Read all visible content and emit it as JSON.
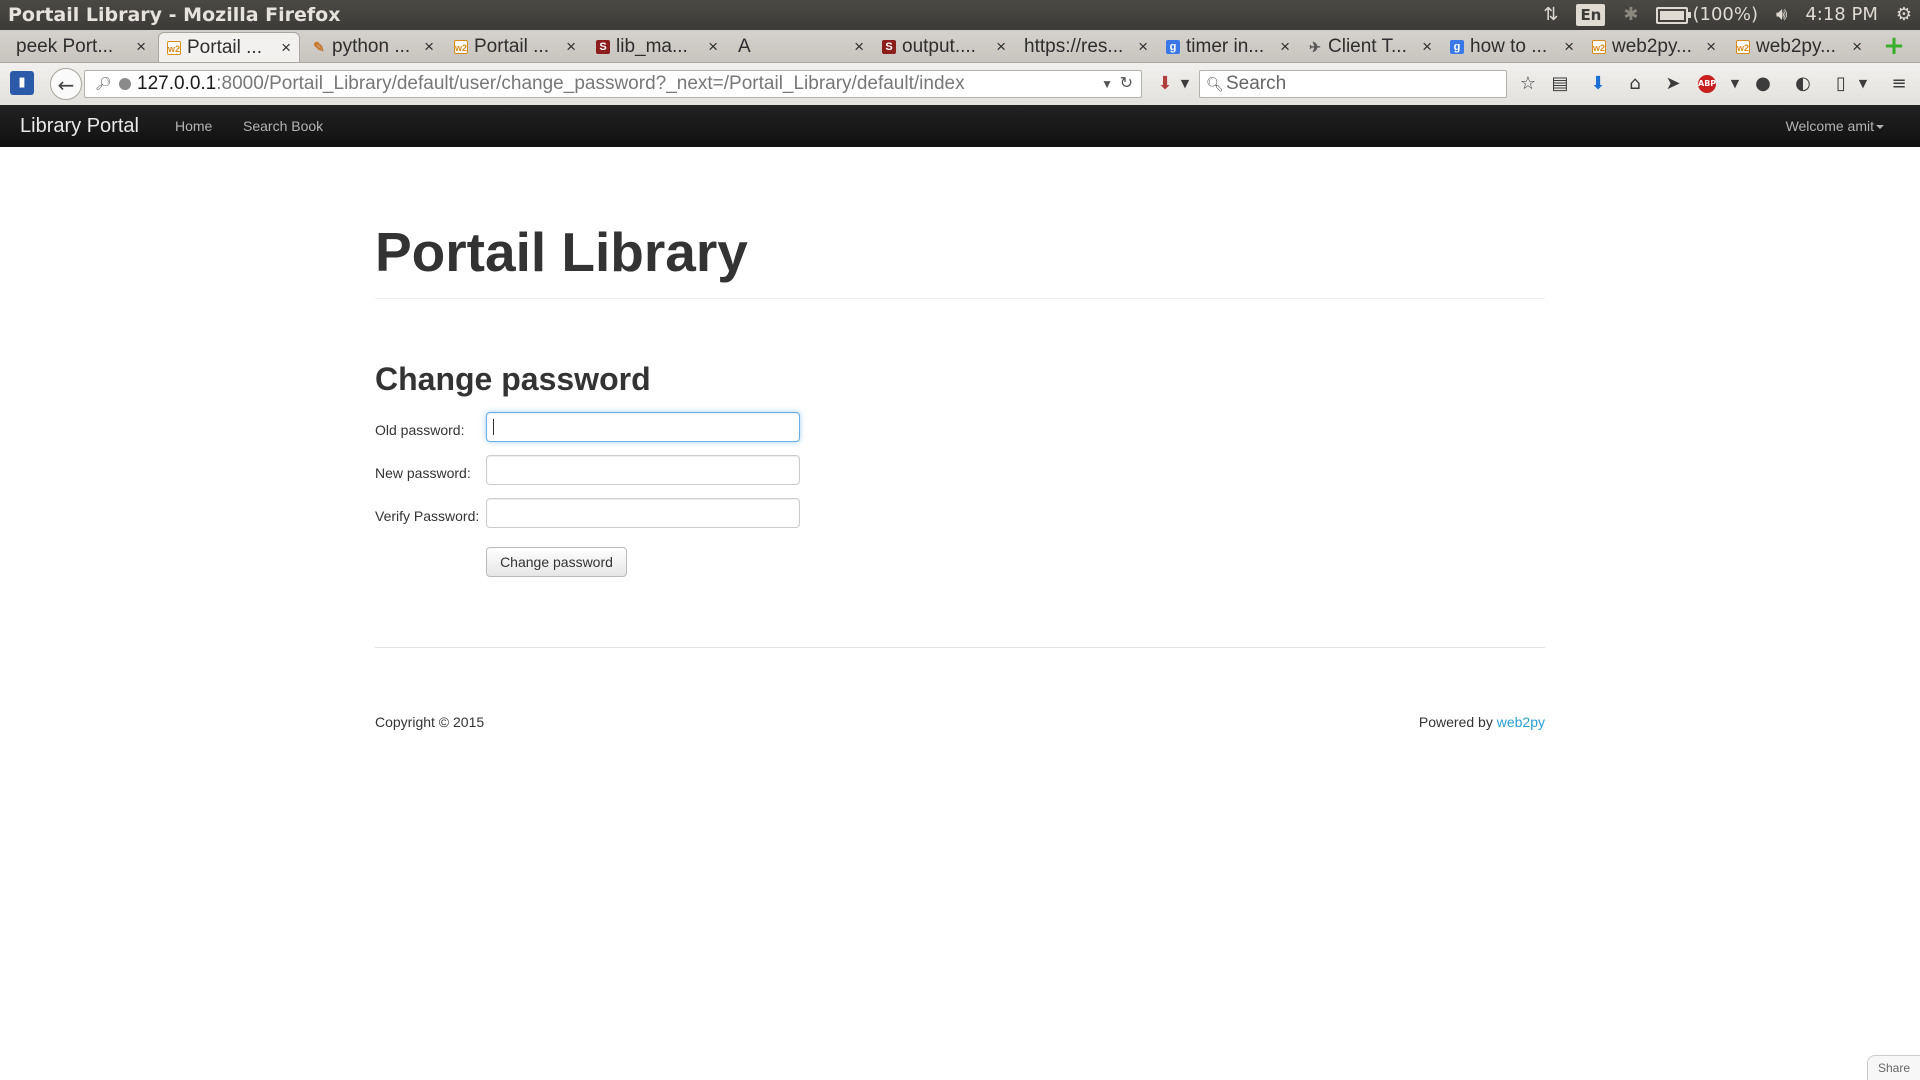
{
  "os": {
    "window_title": "Portail Library - Mozilla Firefox",
    "lang": "En",
    "battery": "(100%)",
    "battery_level": 1.0,
    "time": "4:18 PM"
  },
  "tabs": [
    {
      "label": "peek Port...",
      "icon": "none",
      "active": false
    },
    {
      "label": "Portail ...",
      "icon": "web2py-icon",
      "active": true
    },
    {
      "label": "python ...",
      "icon": "python-icon",
      "active": false
    },
    {
      "label": "Portail ...",
      "icon": "web2py-icon",
      "active": false
    },
    {
      "label": "lib_ma...",
      "icon": "stackoverflow-icon",
      "active": false
    },
    {
      "label": "A",
      "icon": "none",
      "active": false
    },
    {
      "label": "output....",
      "icon": "stackoverflow-icon",
      "active": false
    },
    {
      "label": "https://res...",
      "icon": "none",
      "active": false
    },
    {
      "label": "timer in...",
      "icon": "google-icon",
      "active": false
    },
    {
      "label": "Client T...",
      "icon": "client-icon",
      "active": false
    },
    {
      "label": "how to ...",
      "icon": "google-icon",
      "active": false
    },
    {
      "label": "web2py...",
      "icon": "web2py-icon",
      "active": false
    },
    {
      "label": "web2py...",
      "icon": "web2py-icon",
      "active": false
    }
  ],
  "toolbar": {
    "url_host": "127.0.0.1",
    "url_path": ":8000/Portail_Library/default/user/change_password?_next=/Portail_Library/default/index",
    "search_placeholder": "Search"
  },
  "app": {
    "brand": "Library Portal",
    "nav_home": "Home",
    "nav_search": "Search Book",
    "welcome": "Welcome amit"
  },
  "main": {
    "title": "Portail Library",
    "form_title": "Change password",
    "old_label": "Old password:",
    "new_label": "New password:",
    "verify_label": "Verify Password:",
    "old_value": "",
    "new_value": "",
    "verify_value": "",
    "submit_label": "Change password"
  },
  "footer": {
    "copyright": "Copyright © 2015",
    "powered_by": "Powered by",
    "powered_link": "web2py"
  },
  "share_label": "Share",
  "colors": {
    "link": "#2a9fd6",
    "navbar": "#111111",
    "focus": "#66afe9"
  }
}
